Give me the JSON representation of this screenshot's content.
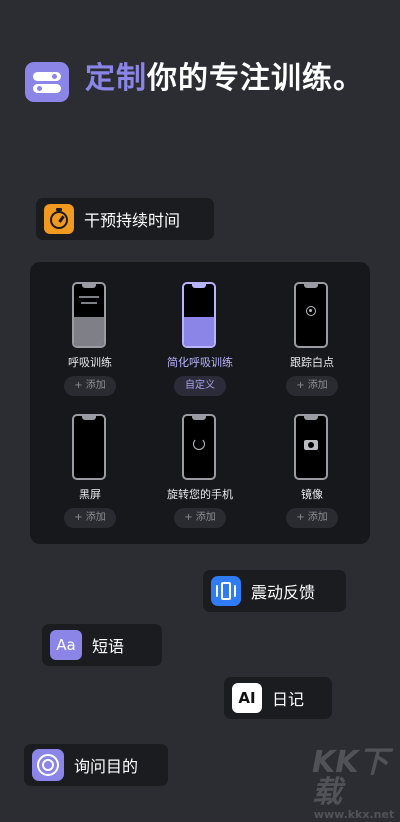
{
  "header": {
    "title_accent": "定制",
    "title_rest": "你的专注训练。"
  },
  "duration_chip": {
    "label": "干预持续时间",
    "icon": "timer-icon"
  },
  "grid": {
    "items": [
      {
        "name": "呼吸训练",
        "button": "+ 添加"
      },
      {
        "name": "简化呼吸训练",
        "button": "自定义"
      },
      {
        "name": "跟踪白点",
        "button": "+ 添加"
      },
      {
        "name": "黑屏",
        "button": "+ 添加"
      },
      {
        "name": "旋转您的手机",
        "button": "+ 添加"
      },
      {
        "name": "镜像",
        "button": "+ 添加"
      }
    ]
  },
  "chips": {
    "vibration": "震动反馈",
    "phrase": "短语",
    "phrase_icon_text": "Aa",
    "diary": "日记",
    "diary_icon_text": "AI",
    "intention": "询问目的"
  },
  "colors": {
    "accent": "#8a85e6",
    "timer": "#f19a1f",
    "vibration": "#2f7cf6",
    "background": "#2b2d33"
  },
  "watermark": {
    "main": "KK下载",
    "sub": "www.kkx.net"
  }
}
